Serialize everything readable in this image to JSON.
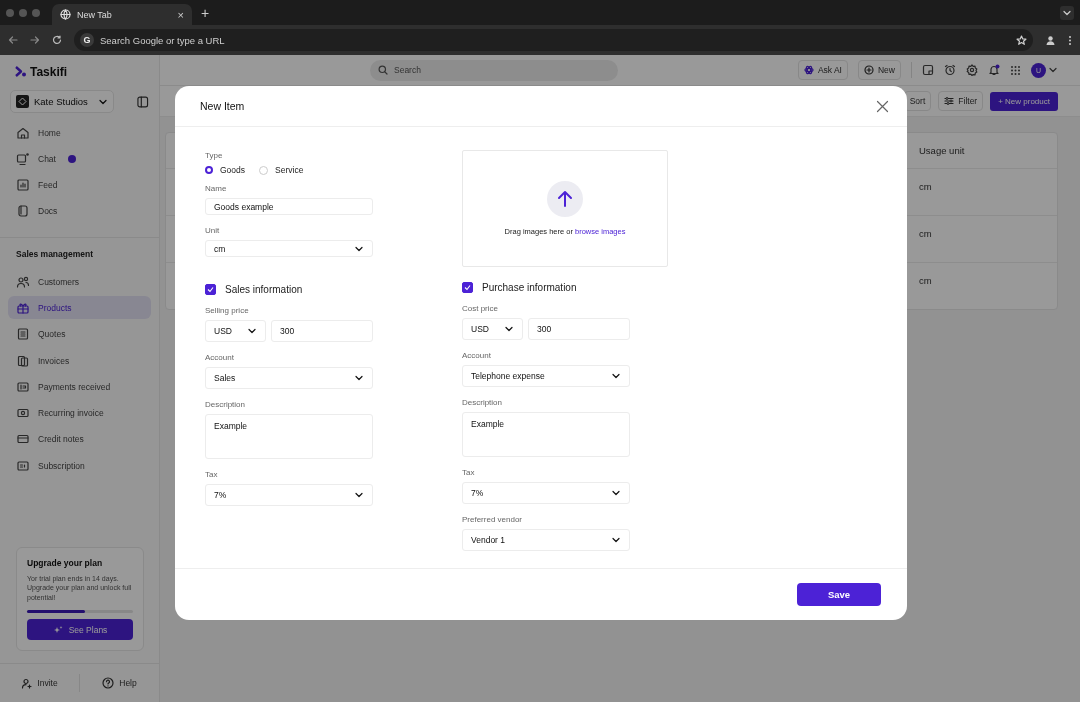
{
  "browser": {
    "tab_title": "New Tab",
    "tab_close": "×",
    "new_tab": "+",
    "engine_mark": "G",
    "address_placeholder": "Search Google or type a URL"
  },
  "sidebar": {
    "logo": "Taskifi",
    "workspace": "Kate Studios",
    "top_items": [
      {
        "label": "Home",
        "selected": false,
        "badge": false
      },
      {
        "label": "Chat",
        "selected": false,
        "badge": true
      },
      {
        "label": "Feed",
        "selected": false,
        "badge": false
      },
      {
        "label": "Docs",
        "selected": false,
        "badge": false
      }
    ],
    "section": {
      "title": "Sales management",
      "items": [
        {
          "label": "Customers",
          "selected": false
        },
        {
          "label": "Products",
          "selected": true
        },
        {
          "label": "Quotes",
          "selected": false
        },
        {
          "label": "Invoices",
          "selected": false
        },
        {
          "label": "Payments received",
          "selected": false
        },
        {
          "label": "Recurring invoice",
          "selected": false
        },
        {
          "label": "Credit notes",
          "selected": false
        },
        {
          "label": "Subscription",
          "selected": false
        }
      ]
    },
    "upgrade": {
      "title": "Upgrade your plan",
      "text": "Yor trial plan ends in 14 days. Upgrade your plan and unlock full potential!",
      "level": 0.55,
      "button": "See Plans"
    },
    "footer": {
      "invite": "Invite",
      "help": "Help"
    }
  },
  "topbar": {
    "search_placeholder": "Search",
    "ask_ai": "Ask AI",
    "new": "New",
    "avatar": "U"
  },
  "content": {
    "sort": "Sort",
    "filter": "Filter",
    "new_product": "+ New product",
    "table": {
      "columns": [
        "Usage unit"
      ],
      "rows": [
        [
          "cm"
        ],
        [
          "cm"
        ],
        [
          "cm"
        ]
      ]
    }
  },
  "modal": {
    "title": "New Item",
    "type": {
      "label": "Type",
      "options": [
        {
          "label": "Goods",
          "selected": true
        },
        {
          "label": "Service",
          "selected": false
        }
      ]
    },
    "name": {
      "label": "Name",
      "value": "Goods example"
    },
    "unit": {
      "label": "Unit",
      "value": "cm"
    },
    "upload": {
      "text": "Drag images here or",
      "link": "browse images"
    },
    "sections": [
      {
        "title": "Sales information",
        "checked": true,
        "price_label": "Selling price",
        "currency": "USD",
        "price": "300",
        "account_label": "Account",
        "account": "Sales",
        "description_label": "Description",
        "description": "Example",
        "tax_label": "Tax",
        "tax": "7%"
      },
      {
        "title": "Purchase information",
        "checked": true,
        "price_label": "Cost price",
        "currency": "USD",
        "price": "300",
        "account_label": "Account",
        "account": "Telephone expense",
        "description_label": "Description",
        "description": "Example",
        "tax_label": "Tax",
        "tax": "7%",
        "vendor_label": "Preferred vendor",
        "vendor": "Vendor 1"
      }
    ],
    "save": "Save"
  }
}
